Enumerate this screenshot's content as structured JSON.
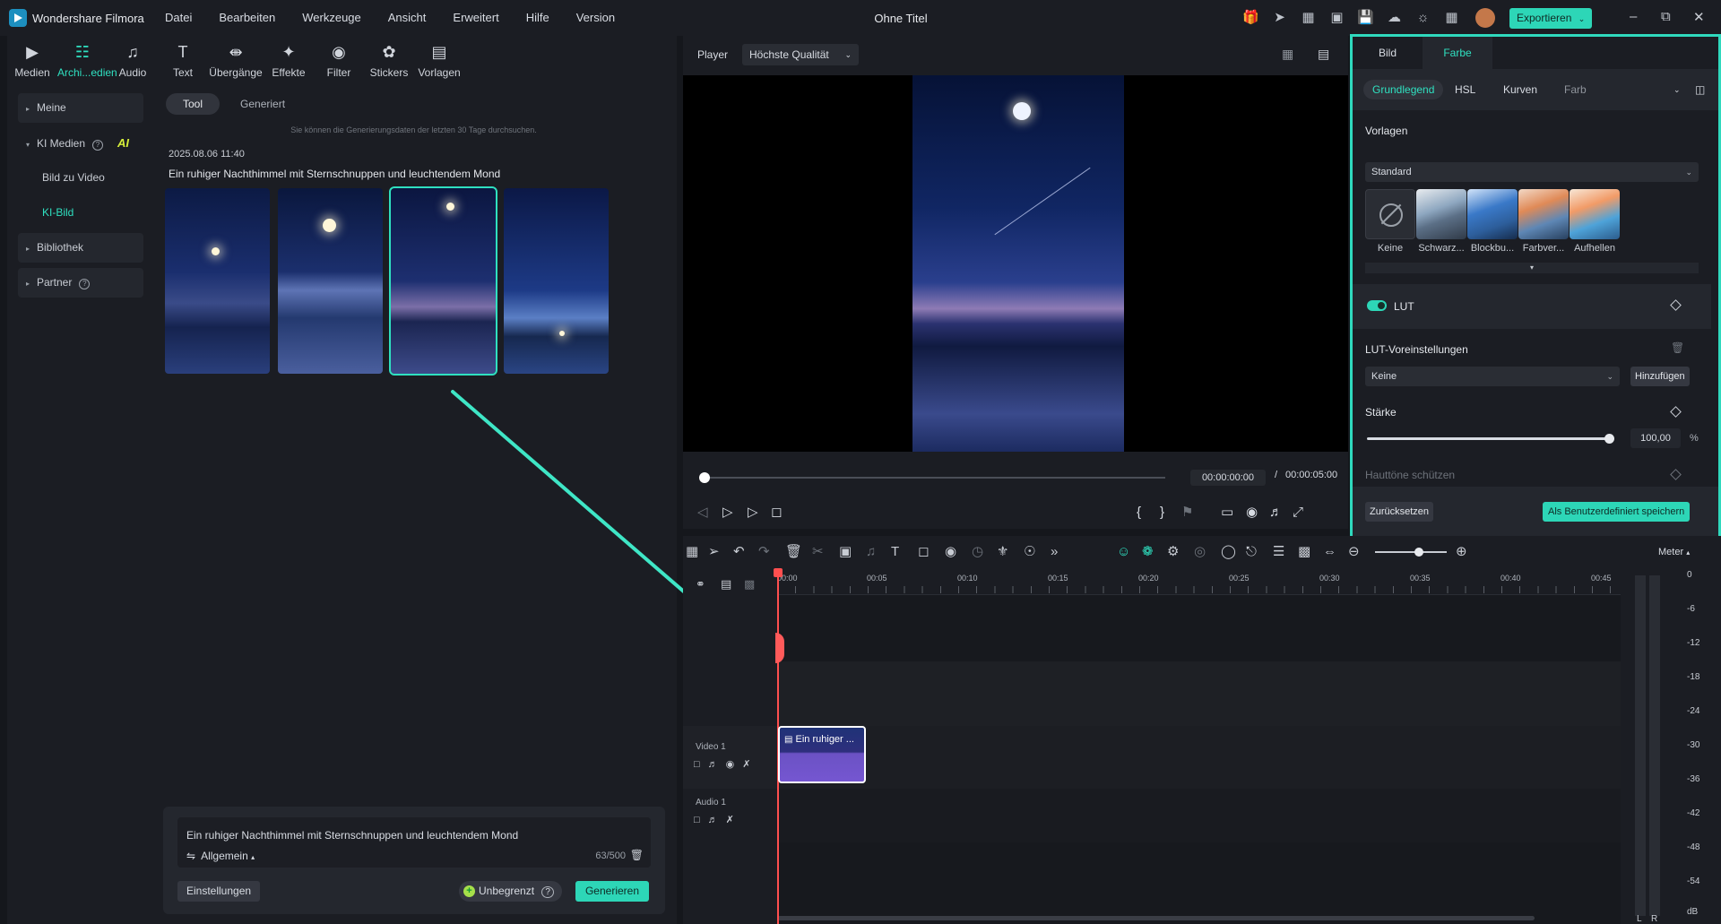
{
  "titlebar": {
    "app_name": "Wondershare Filmora",
    "menu": [
      "Datei",
      "Bearbeiten",
      "Werkzeuge",
      "Ansicht",
      "Erweitert",
      "Hilfe",
      "Version"
    ],
    "document_title": "Ohne Titel",
    "export_label": "Exportieren"
  },
  "mediabar": {
    "tabs": [
      {
        "label": "Medien",
        "icon": "media-icon"
      },
      {
        "label": "Archi...edien",
        "icon": "archive-media-icon"
      },
      {
        "label": "Audio",
        "icon": "music-note-icon"
      },
      {
        "label": "Text",
        "icon": "text-icon"
      },
      {
        "label": "Übergänge",
        "icon": "transitions-icon"
      },
      {
        "label": "Effekte",
        "icon": "effects-icon"
      },
      {
        "label": "Filter",
        "icon": "filter-icon"
      },
      {
        "label": "Stickers",
        "icon": "sticker-icon"
      },
      {
        "label": "Vorlagen",
        "icon": "templates-icon"
      }
    ],
    "active_index": 1
  },
  "sidebar": {
    "items": [
      {
        "label": "Meine"
      },
      {
        "label": "KI Medien",
        "badge": "AI"
      },
      {
        "label": "Bild zu Video"
      },
      {
        "label": "KI-Bild"
      },
      {
        "label": "Bibliothek"
      },
      {
        "label": "Partner"
      }
    ]
  },
  "library": {
    "tabs": [
      "Tool",
      "Generiert"
    ],
    "hint": "Sie können die Generierungsdaten der letzten 30 Tage durchsuchen.",
    "date": "2025.08.06 11:40",
    "prompt_title": "Ein ruhiger Nachthimmel mit Sternschnuppen und leuchtendem Mond",
    "selected_thumbnail": 3
  },
  "prompt_box": {
    "text": "Ein ruhiger Nachthimmel mit Sternschnuppen und leuchtendem Mond",
    "mode": "Allgemein",
    "count": "63/500",
    "settings_label": "Einstellungen",
    "unlimited_label": "Unbegrenzt",
    "generate_label": "Generieren"
  },
  "player": {
    "label": "Player",
    "quality": "Höchste Qualität",
    "current_time": "00:00:00:00",
    "separator": "/",
    "total_time": "00:00:05:00"
  },
  "properties": {
    "top_tabs": [
      "Bild",
      "Farbe"
    ],
    "sub_tabs": [
      "Grundlegend",
      "HSL",
      "Kurven",
      "Farb"
    ],
    "templates_title": "Vorlagen",
    "templates_dropdown": "Standard",
    "presets": [
      "Keine",
      "Schwarz...",
      "Blockbu...",
      "Farbver...",
      "Aufhellen"
    ],
    "lut_label": "LUT",
    "lut_presets_label": "LUT-Voreinstellungen",
    "lut_dropdown": "Keine",
    "add_label": "Hinzufügen",
    "strength_label": "Stärke",
    "strength_value": "100,00",
    "strength_unit": "%",
    "skin_label": "Hauttöne schützen",
    "reset_label": "Zurücksetzen",
    "save_custom_label": "Als Benutzerdefiniert speichern"
  },
  "timeline": {
    "ruler_ticks": [
      "00:00",
      "00:05",
      "00:10",
      "00:15",
      "00:20",
      "00:25",
      "00:30",
      "00:35",
      "00:40",
      "00:45"
    ],
    "tracks": [
      {
        "name": "Video 1"
      },
      {
        "name": "Audio 1"
      }
    ],
    "clip_label": "Ein ruhiger ..."
  },
  "meter": {
    "label": "Meter",
    "scale": [
      "0",
      "-6",
      "-12",
      "-18",
      "-24",
      "-30",
      "-36",
      "-42",
      "-48",
      "-54",
      "dB"
    ],
    "channels": [
      "L",
      "R"
    ]
  },
  "colors": {
    "accent": "#2dd6b7",
    "playhead": "#ff4f4f",
    "badge_ai": "#d6ef3a"
  }
}
